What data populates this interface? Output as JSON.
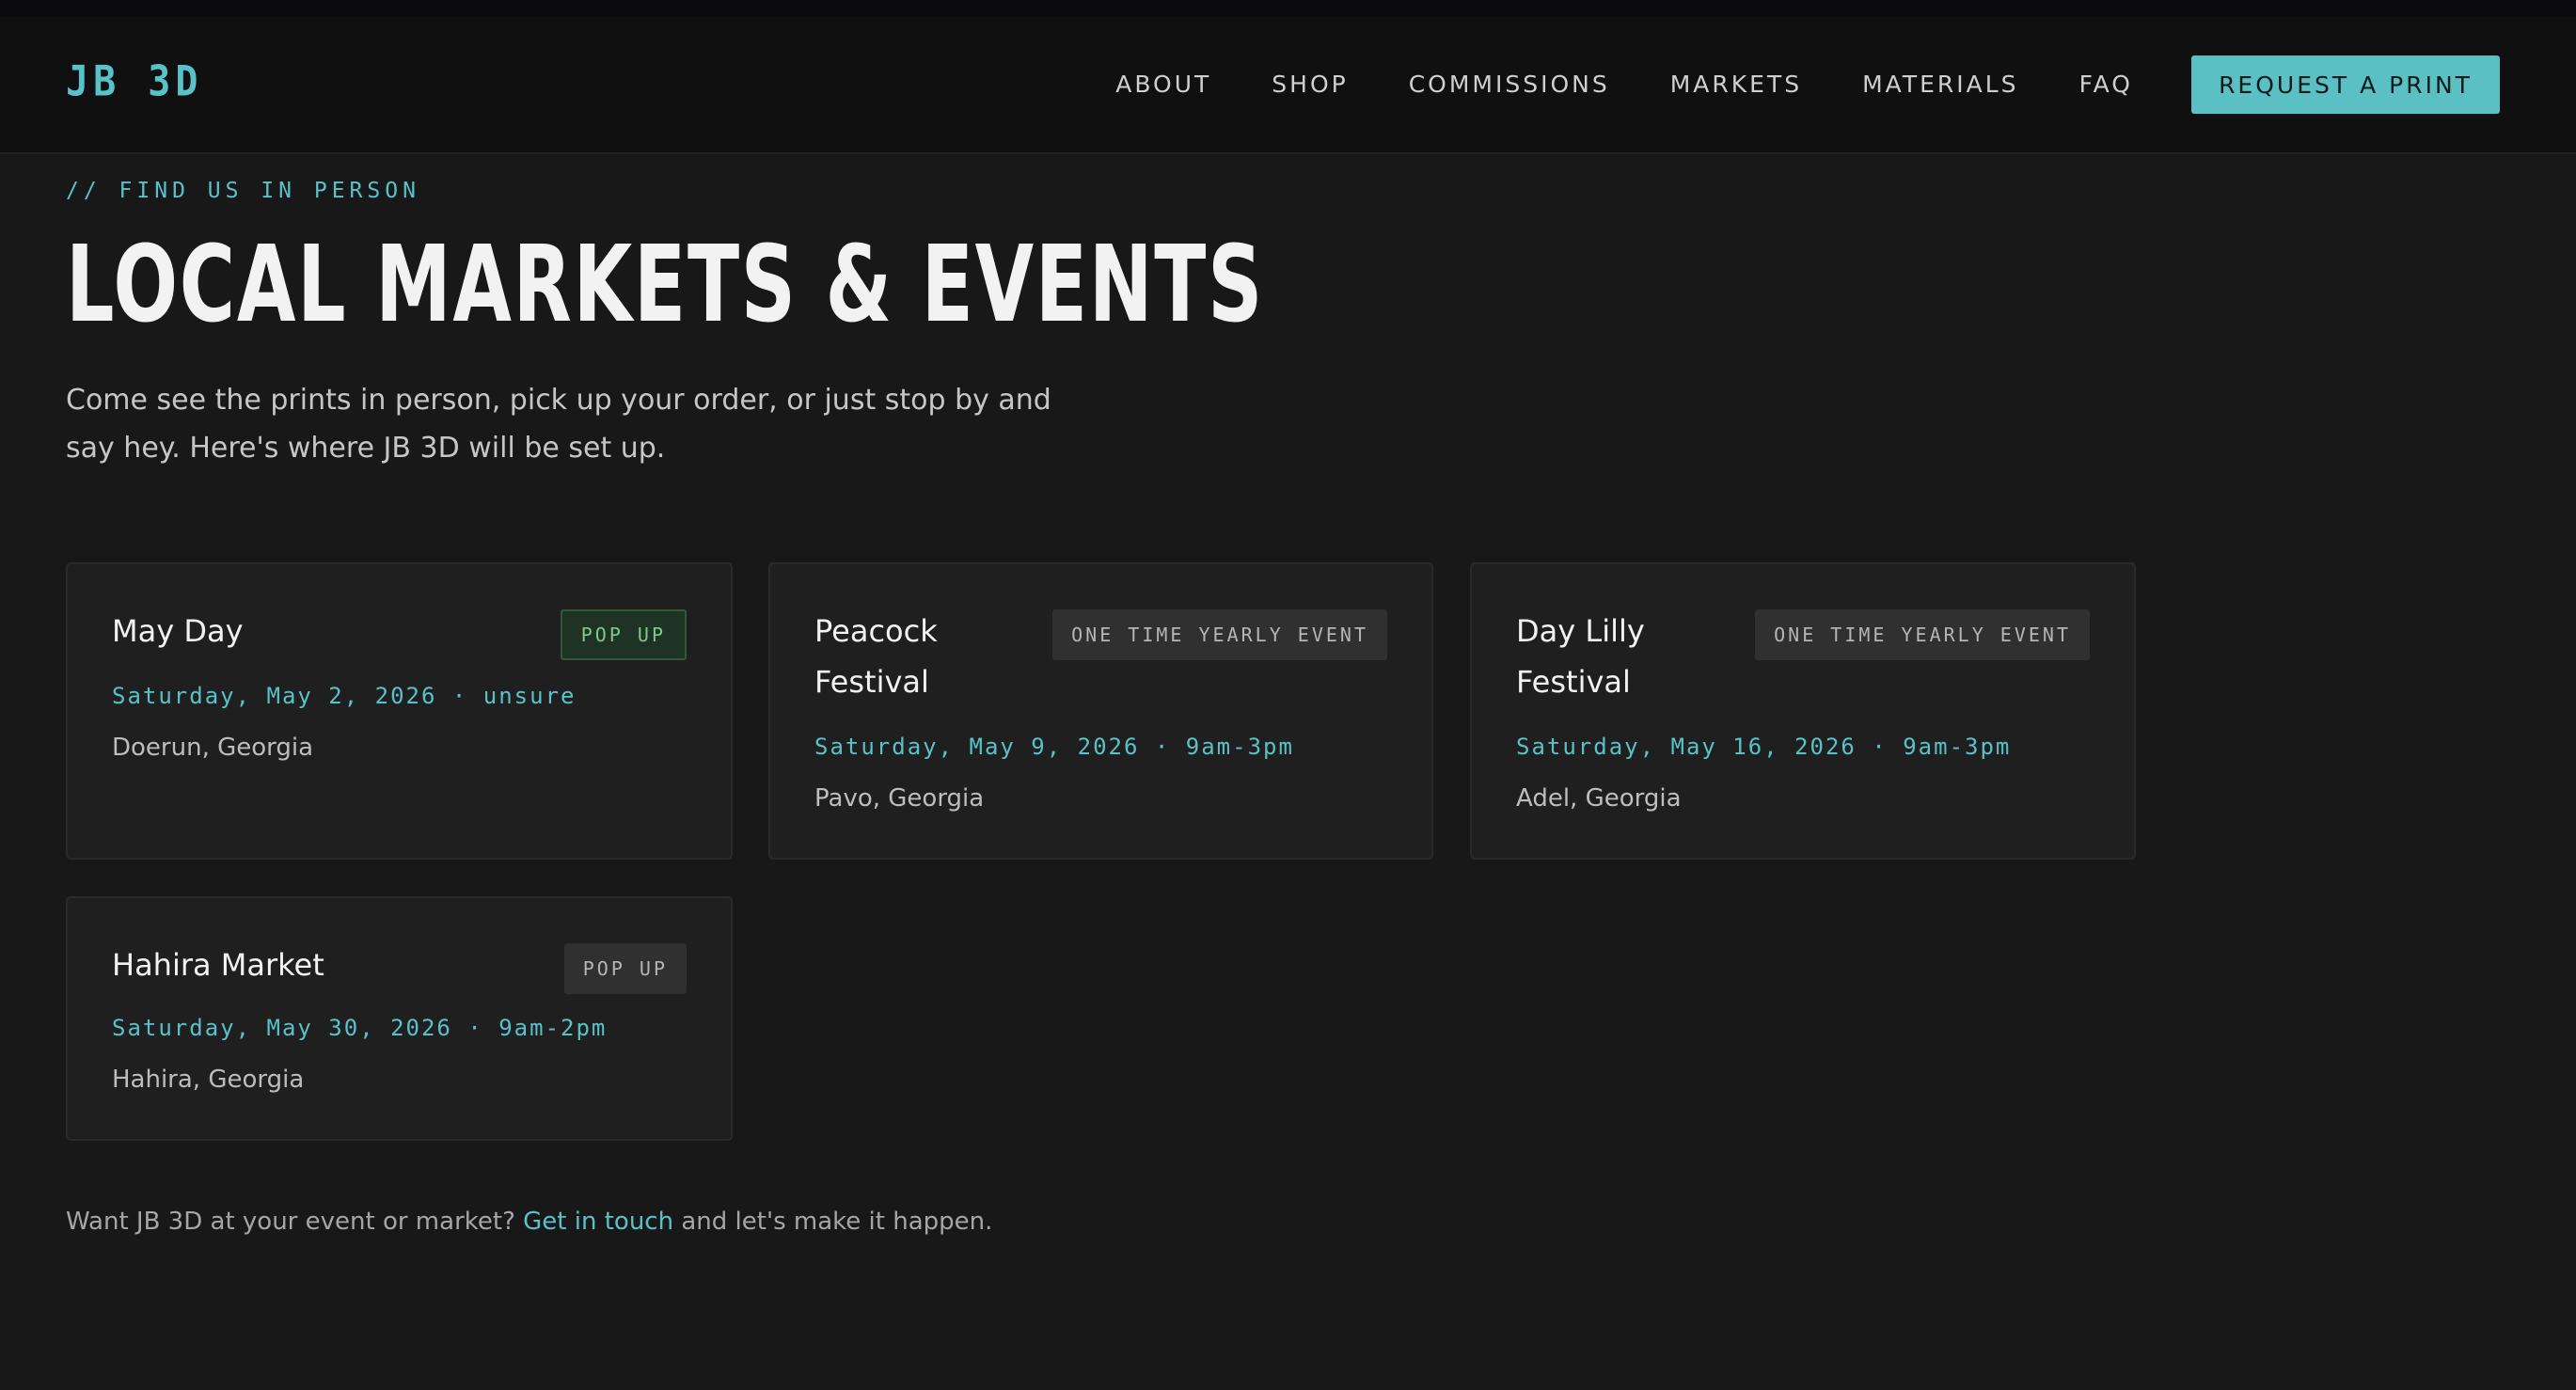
{
  "brand": {
    "logo": "JB 3D"
  },
  "nav": {
    "items": [
      "ABOUT",
      "SHOP",
      "COMMISSIONS",
      "MARKETS",
      "MATERIALS",
      "FAQ"
    ],
    "cta": "REQUEST A PRINT"
  },
  "hero": {
    "eyebrow": "// FIND US IN PERSON",
    "title": "LOCAL MARKETS & EVENTS",
    "intro": "Come see the prints in person, pick up your order, or just stop by and say hey. Here's where JB 3D will be set up."
  },
  "events": [
    {
      "title": "May Day",
      "badge": "POP UP",
      "date": "Saturday, May 2, 2026 · unsure",
      "location": "Doerun, Georgia"
    },
    {
      "title": "Peacock Festival",
      "badge": "ONE TIME YEARLY EVENT",
      "date": "Saturday, May 9, 2026 · 9am-3pm",
      "location": "Pavo, Georgia"
    },
    {
      "title": "Day Lilly Festival",
      "badge": "ONE TIME YEARLY EVENT",
      "date": "Saturday, May 16, 2026 · 9am-3pm",
      "location": "Adel, Georgia"
    },
    {
      "title": "Hahira Market",
      "badge": "POP UP",
      "date": "Saturday, May 30, 2026 · 9am-2pm",
      "location": "Hahira, Georgia"
    }
  ],
  "footer": {
    "before": "Want JB 3D at your event or market? ",
    "link": "Get in touch",
    "after": " and let's make it happen."
  },
  "colors": {
    "accent": "#5bc0c4",
    "background": "#181818",
    "card": "#1f1f1f",
    "popup_badge_green": "#7ec98c"
  }
}
